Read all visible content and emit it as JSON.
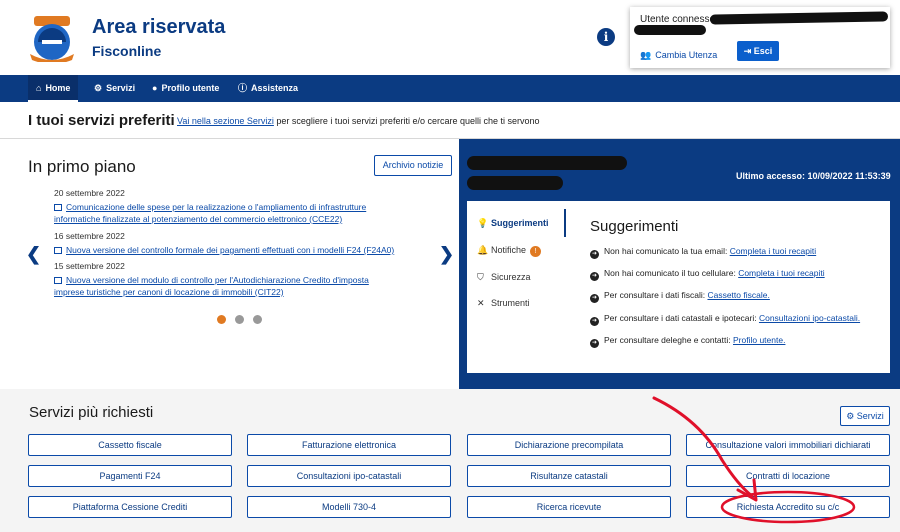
{
  "header": {
    "title": "Area riservata",
    "subtitle": "Fisconline",
    "info_icon": "i",
    "user_label": "Utente connesso:",
    "switch_user": "Cambia Utenza",
    "logout": "Esci"
  },
  "nav": {
    "items": [
      {
        "label": "Home",
        "icon": "home-icon"
      },
      {
        "label": "Servizi",
        "icon": "gears-icon"
      },
      {
        "label": "Profilo utente",
        "icon": "user-icon"
      },
      {
        "label": "Assistenza",
        "icon": "info-icon"
      }
    ]
  },
  "favorites": {
    "title": "I tuoi servizi preferiti",
    "link": "Vai nella sezione Servizi",
    "text": " per scegliere i tuoi servizi preferiti e/o cercare quelli che ti servono"
  },
  "news": {
    "title": "In primo piano",
    "archive_button": "Archivio notizie",
    "items": [
      {
        "date": "20 settembre 2022",
        "line1": "Comunicazione delle spese per la realizzazione o l'ampliamento di infrastrutture",
        "line2": "informatiche finalizzate al potenziamento del commercio elettronico (CCE22)"
      },
      {
        "date": "16 settembre 2022",
        "line1": "Nuova versione del controllo formale dei pagamenti effettuati con i modelli F24 (F24A0)",
        "line2": ""
      },
      {
        "date": "15 settembre 2022",
        "line1": "Nuova versione del modulo di controllo per l'Autodichiarazione Credito d'imposta",
        "line2": "imprese turistiche per canoni di locazione di immobili (CIT22)"
      }
    ]
  },
  "panel": {
    "last_access": "Ultimo accesso: 10/09/2022 11:53:39",
    "menu": [
      {
        "label": "Suggerimenti",
        "icon": "lightbulb-icon",
        "active": true
      },
      {
        "label": "Notifiche",
        "icon": "bell-icon",
        "badge": "!"
      },
      {
        "label": "Sicurezza",
        "icon": "shield-icon"
      },
      {
        "label": "Strumenti",
        "icon": "tools-icon"
      }
    ],
    "title": "Suggerimenti",
    "suggestions": [
      {
        "text": "Non hai comunicato la tua email: ",
        "link": "Completa i tuoi recapiti"
      },
      {
        "text": "Non hai comunicato il tuo cellulare: ",
        "link": "Completa i tuoi recapiti"
      },
      {
        "text": "Per consultare i dati fiscali: ",
        "link": "Cassetto fiscale."
      },
      {
        "text": "Per consultare i dati catastali e ipotecari: ",
        "link": "Consultazioni ipo-catastali."
      },
      {
        "text": "Per consultare deleghe e contatti: ",
        "link": "Profilo utente."
      }
    ]
  },
  "services": {
    "title": "Servizi più richiesti",
    "button": "Servizi",
    "items": [
      "Cassetto fiscale",
      "Fatturazione elettronica",
      "Dichiarazione precompilata",
      "Consultazione valori immobiliari dichiarati",
      "Pagamenti F24",
      "Consultazioni ipo-catastali",
      "Risultanze catastali",
      "Contratti di locazione",
      "Piattaforma Cessione Crediti",
      "Modelli 730-4",
      "Ricerca ricevute",
      "Richiesta Accredito su c/c"
    ]
  },
  "colors": {
    "brand_blue": "#0b3b82",
    "link_blue": "#0b4aa8",
    "accent_orange": "#e07a22",
    "annotation_red": "#e0102a"
  }
}
